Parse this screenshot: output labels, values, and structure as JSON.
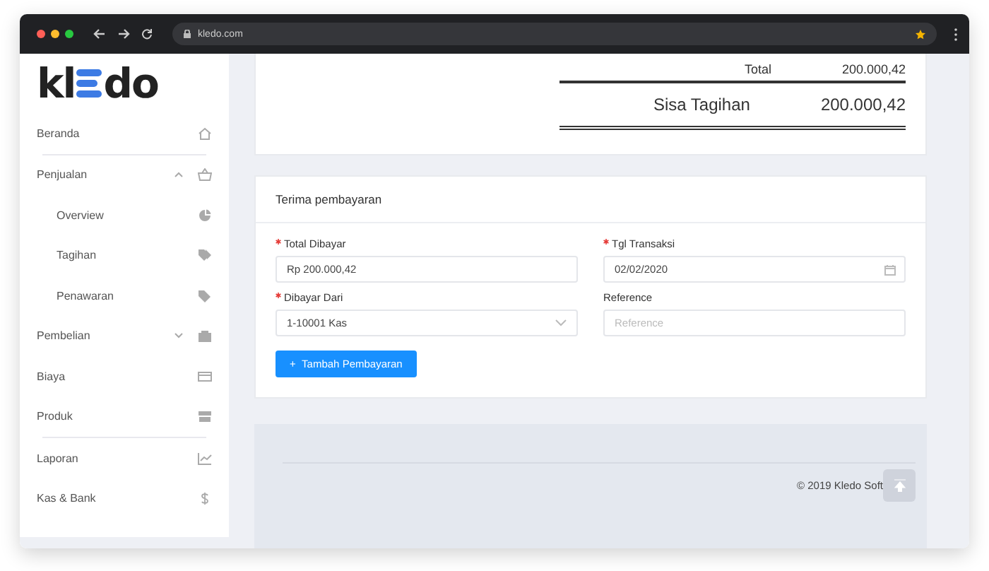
{
  "browser": {
    "url": "kledo.com"
  },
  "logo": {
    "before": "kl",
    "after": "do"
  },
  "sidebar": {
    "items": [
      {
        "kind": "item",
        "label": "Beranda",
        "divider_after": true
      },
      {
        "kind": "group",
        "label": "Penjualan",
        "expanded": true,
        "children": [
          {
            "label": "Overview"
          },
          {
            "label": "Tagihan"
          },
          {
            "label": "Penawaran"
          }
        ]
      },
      {
        "kind": "group",
        "label": "Pembelian",
        "expanded": false
      },
      {
        "kind": "item",
        "label": "Biaya"
      },
      {
        "kind": "item",
        "label": "Produk",
        "divider_after": true
      },
      {
        "kind": "item",
        "label": "Laporan"
      },
      {
        "kind": "item",
        "label": "Kas & Bank"
      }
    ]
  },
  "summary": {
    "rows": [
      {
        "label": "Total",
        "value": "200.000,42",
        "kind": "normal"
      },
      {
        "label": "Sisa Tagihan",
        "value": "200.000,42",
        "kind": "grand"
      }
    ]
  },
  "payment": {
    "title": "Terima pembayaran",
    "fields": [
      {
        "label": "Total Dibayar",
        "required": true,
        "kind": "text",
        "value": "Rp 200.000,42"
      },
      {
        "label": "Tgl Transaksi",
        "required": true,
        "kind": "date",
        "value": "02/02/2020"
      },
      {
        "label": "Dibayar Dari",
        "required": true,
        "kind": "select",
        "value": "1-10001 Kas"
      },
      {
        "label": "Reference",
        "required": false,
        "kind": "text",
        "placeholder": "Reference"
      }
    ],
    "button": {
      "icon": "+",
      "label": "Tambah Pembayaran"
    }
  },
  "footer": {
    "copyright": "© 2019 Kledo Soft"
  }
}
